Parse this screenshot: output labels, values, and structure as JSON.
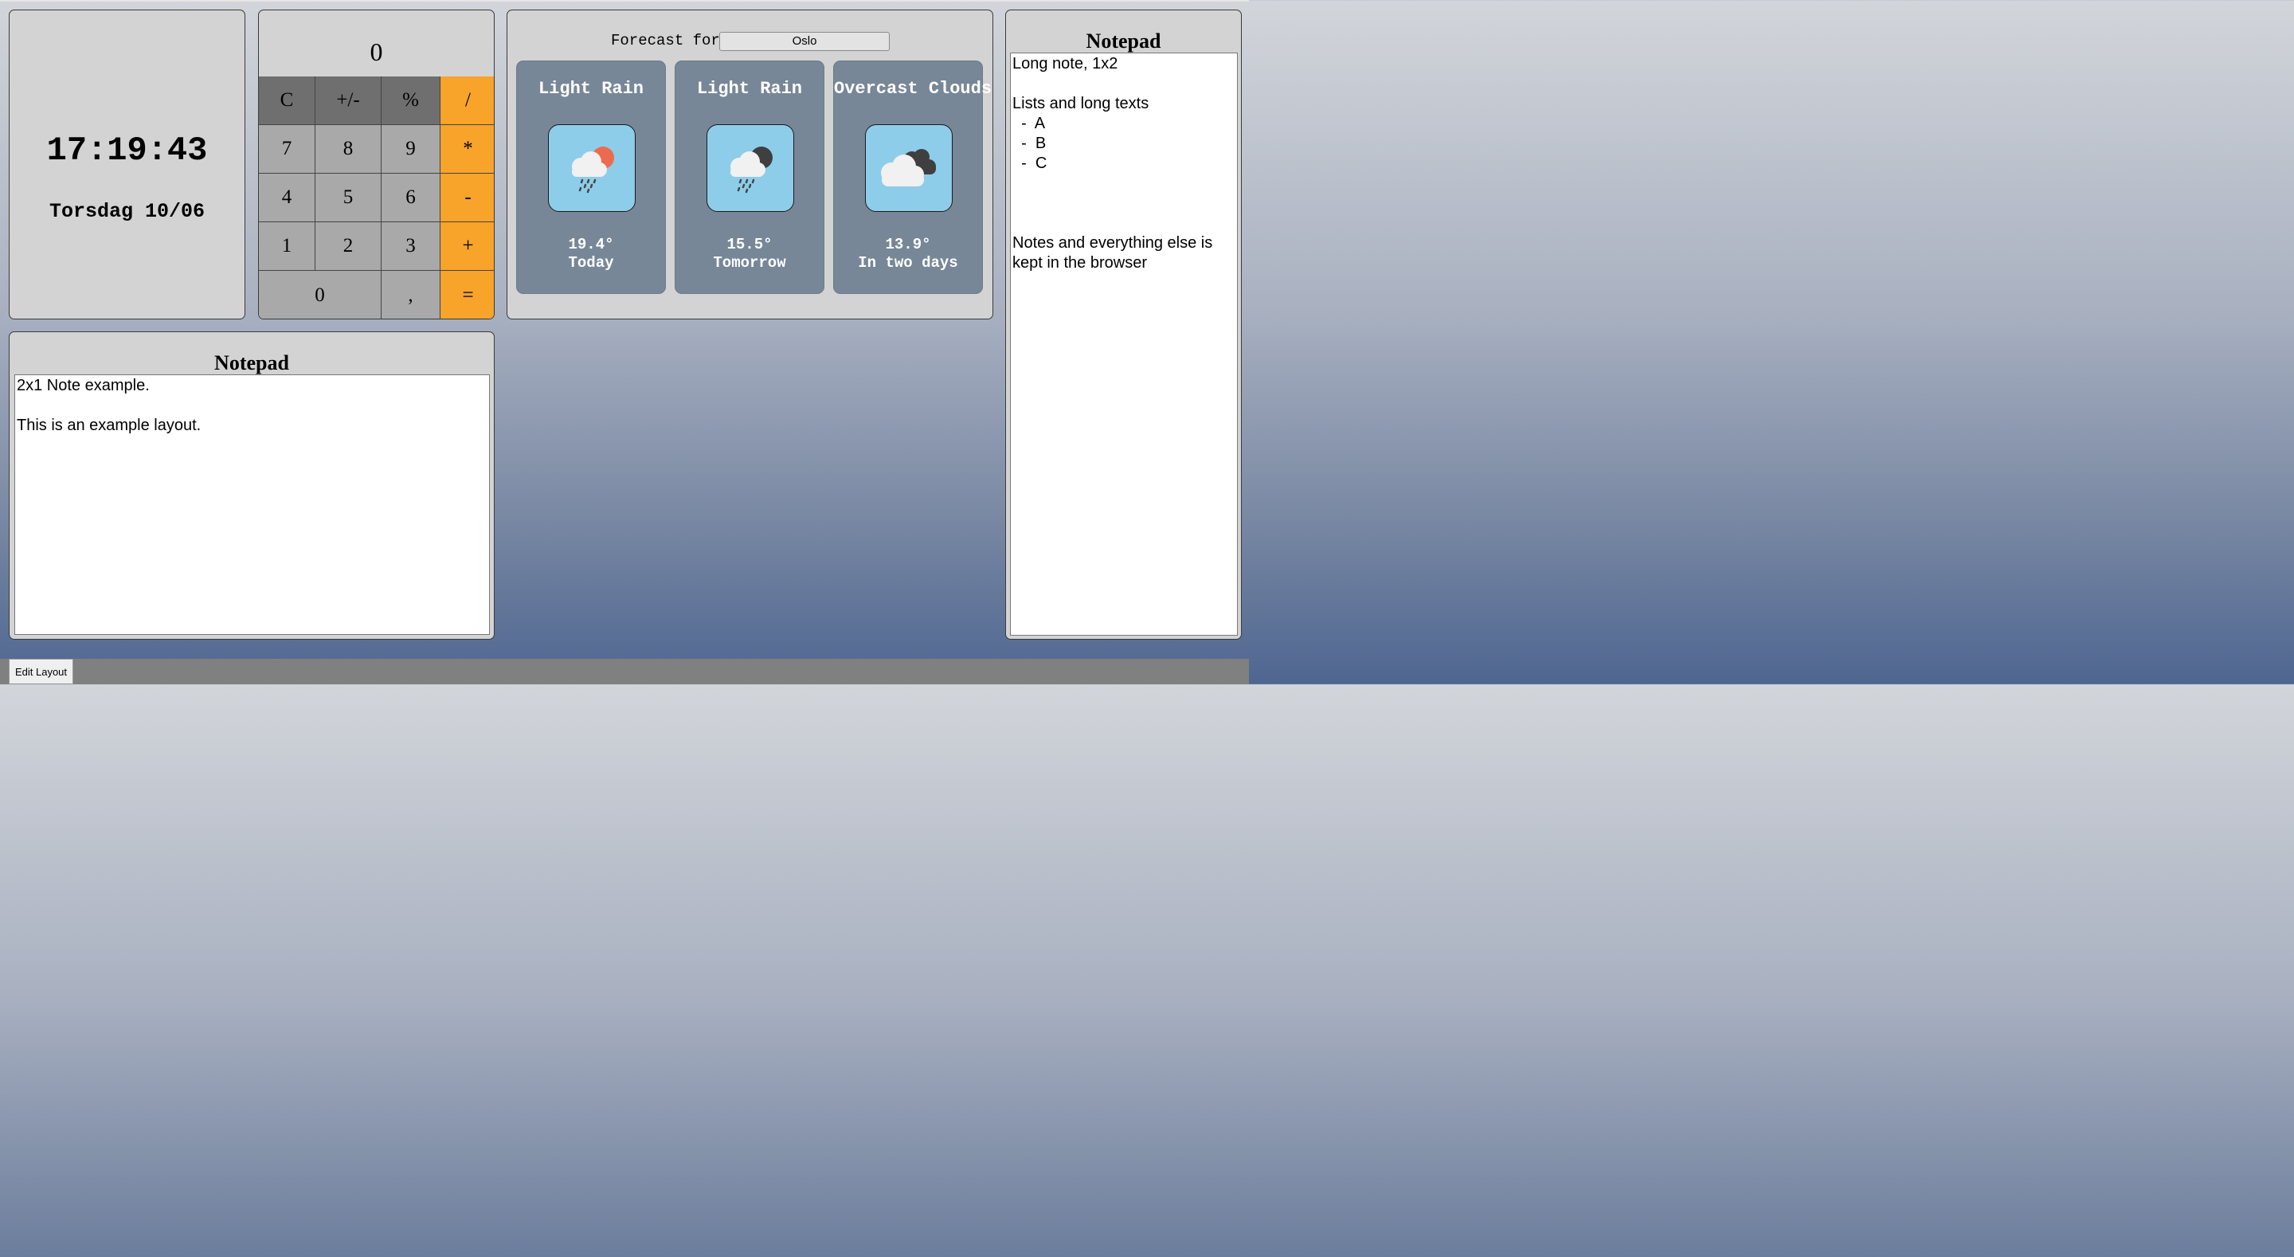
{
  "clock": {
    "time": "17:19:43",
    "date": "Torsdag 10/06"
  },
  "calculator": {
    "display": "0",
    "keys": [
      {
        "label": "C",
        "kind": "fn"
      },
      {
        "label": "+/-",
        "kind": "fn"
      },
      {
        "label": "%",
        "kind": "fn"
      },
      {
        "label": "/",
        "kind": "op"
      },
      {
        "label": "7",
        "kind": "num"
      },
      {
        "label": "8",
        "kind": "num"
      },
      {
        "label": "9",
        "kind": "num"
      },
      {
        "label": "*",
        "kind": "op"
      },
      {
        "label": "4",
        "kind": "num"
      },
      {
        "label": "5",
        "kind": "num"
      },
      {
        "label": "6",
        "kind": "num"
      },
      {
        "label": "-",
        "kind": "op"
      },
      {
        "label": "1",
        "kind": "num"
      },
      {
        "label": "2",
        "kind": "num"
      },
      {
        "label": "3",
        "kind": "num"
      },
      {
        "label": "+",
        "kind": "op"
      },
      {
        "label": "0",
        "kind": "num-wide"
      },
      {
        "label": ",",
        "kind": "num"
      },
      {
        "label": "=",
        "kind": "op"
      }
    ],
    "colors": {
      "function": "#6f6f6f",
      "number": "#a9a9a9",
      "operator": "#f8a32a"
    }
  },
  "weather": {
    "label": "Forecast for",
    "location": "Oslo",
    "days": [
      {
        "description": "Light Rain",
        "temperature": "19.4°",
        "day": "Today",
        "icon": "rain-cloud-sun-icon"
      },
      {
        "description": "Light Rain",
        "temperature": "15.5°",
        "day": "Tomorrow",
        "icon": "rain-cloud-moon-icon"
      },
      {
        "description": "Overcast Clouds",
        "temperature": "13.9°",
        "day": "In two days",
        "icon": "overcast-clouds-icon"
      }
    ]
  },
  "notepad_wide": {
    "title": "Notepad",
    "text": "2x1 Note example.\n\nThis is an example layout."
  },
  "notepad_tall": {
    "title": "Notepad",
    "text": "Long note, 1x2\n\nLists and long texts\n  -  A\n  -  B\n  -  C\n\n\n\nNotes and everything else is kept in the browser"
  },
  "toolbar": {
    "edit_layout": "Edit Layout"
  }
}
